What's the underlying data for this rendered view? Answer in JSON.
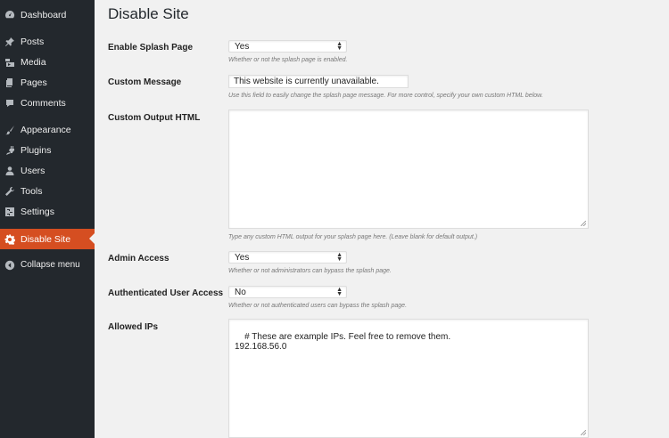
{
  "sidebar": {
    "items": [
      {
        "label": "Dashboard",
        "icon": "dashboard-icon"
      },
      {
        "label": "Posts",
        "icon": "pin-icon"
      },
      {
        "label": "Media",
        "icon": "media-icon"
      },
      {
        "label": "Pages",
        "icon": "pages-icon"
      },
      {
        "label": "Comments",
        "icon": "comments-icon"
      },
      {
        "label": "Appearance",
        "icon": "brush-icon"
      },
      {
        "label": "Plugins",
        "icon": "plug-icon"
      },
      {
        "label": "Users",
        "icon": "user-icon"
      },
      {
        "label": "Tools",
        "icon": "wrench-icon"
      },
      {
        "label": "Settings",
        "icon": "settings-icon"
      },
      {
        "label": "Disable Site",
        "icon": "gear-icon"
      }
    ],
    "collapse_label": "Collapse menu",
    "accent_color": "#d54e21"
  },
  "page": {
    "title": "Disable Site",
    "fields": {
      "splash": {
        "label": "Enable Splash Page",
        "value": "Yes",
        "description": "Whether or not the splash page is enabled."
      },
      "message": {
        "label": "Custom Message",
        "value": "This website is currently unavailable.",
        "description": "Use this field to easily change the splash page message. For more control, specify your own custom HTML below."
      },
      "html": {
        "label": "Custom Output HTML",
        "value": "",
        "description": "Type any custom HTML output for your splash page here. (Leave blank for default output.)"
      },
      "admin": {
        "label": "Admin Access",
        "value": "Yes",
        "description": "Whether or not administrators can bypass the splash page."
      },
      "auth": {
        "label": "Authenticated User Access",
        "value": "No",
        "description": "Whether or not authenticated users can bypass the splash page."
      },
      "ips": {
        "label": "Allowed IPs",
        "value": "# These are example IPs. Feel free to remove them.\n192.168.56.0"
      }
    }
  }
}
